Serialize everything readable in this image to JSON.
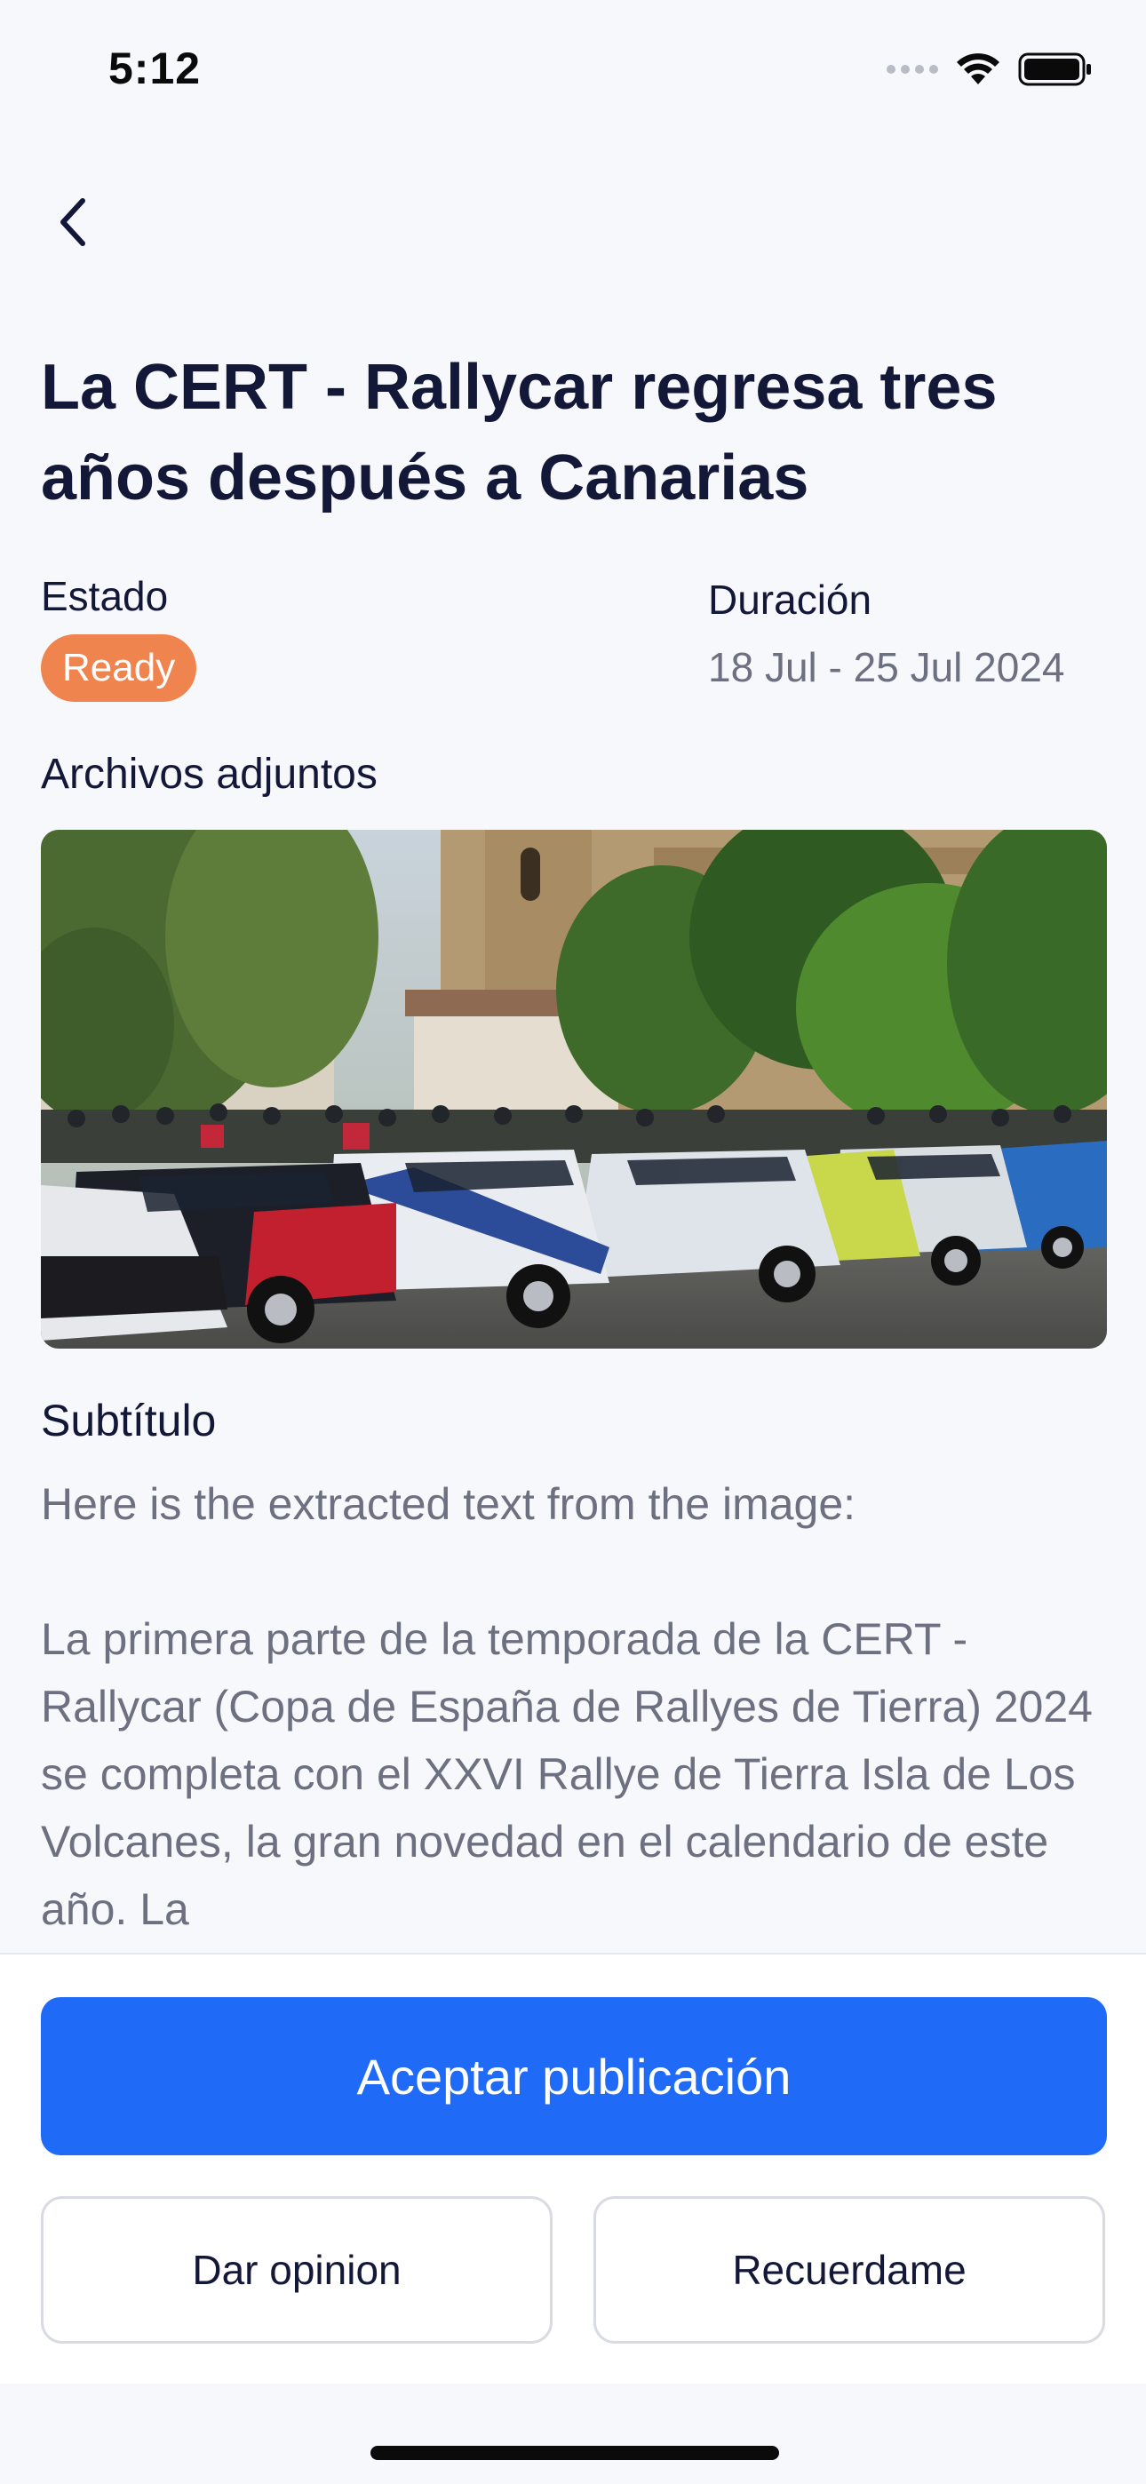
{
  "status_bar": {
    "time": "5:12"
  },
  "header": {
    "back_icon": "chevron-left-icon",
    "title": "La CERT - Rallycar regresa tres años después a Canarias"
  },
  "details": {
    "estado_label": "Estado",
    "estado_value": "Ready",
    "estado_color": "#f0844e",
    "duracion_label": "Duración",
    "duracion_value": "18 Jul - 25 Jul 2024"
  },
  "attachments": {
    "label": "Archivos adjuntos",
    "image_icon": "rally-cars-photo"
  },
  "subtitle": {
    "label": "Subtítulo",
    "intro": "Here is the extracted text from the image:",
    "body": "La primera parte de la temporada de la CERT - Rallycar (Copa de España de Rallyes de Tierra) 2024 se completa con el XXVI Rallye de Tierra Isla de Los Volcanes, la gran novedad en el calendario de este año. La"
  },
  "actions": {
    "accept_label": "Aceptar publicación",
    "opinion_label": "Dar opinion",
    "remind_label": "Recuerdame",
    "accent_color": "#1f6bf7"
  }
}
